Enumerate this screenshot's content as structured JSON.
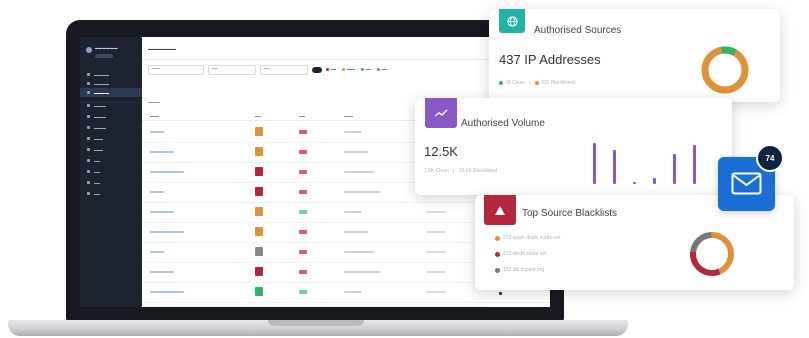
{
  "colors": {
    "teal": "#22b2a5",
    "purple": "#8a58c4",
    "red": "#b5263d",
    "orange": "#e09238",
    "green": "#2fb36b",
    "blue": "#1a6fd6"
  },
  "cards": {
    "authorised_sources": {
      "title": "Authorised Sources",
      "icon": "globe-icon",
      "main_value": "437 IP Addresses",
      "clean": "78 Clean",
      "blacklisted": "338 Blacklisted"
    },
    "authorised_volume": {
      "title": "Authorised Volume",
      "icon": "trend-line-icon",
      "main_value": "12.5K",
      "clean": "1.9K Clean",
      "blacklisted": "10.5K Blacklisted",
      "bars": [
        0.9,
        0.75,
        0.05,
        0.12,
        0.65,
        0.85
      ]
    },
    "top_source_blacklists": {
      "title": "Top Source Blacklists",
      "icon": "warning-triangle-icon",
      "items": [
        {
          "label": "273 spam dnsbl sorbs net",
          "color": "#e09238"
        },
        {
          "label": "233 dnsbl sorbs net",
          "color": "#b5263d"
        },
        {
          "label": "152 dbl.itspam.org",
          "color": "#777777"
        }
      ]
    }
  },
  "notification": {
    "count": "74",
    "icon": "mail-icon"
  }
}
